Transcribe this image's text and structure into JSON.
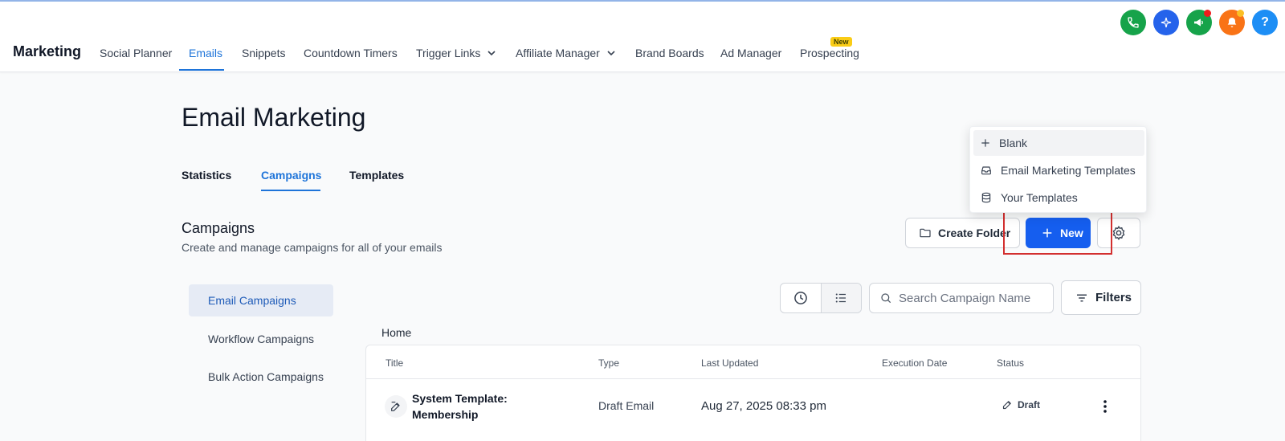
{
  "app": {
    "brand": "Marketing",
    "nav": [
      {
        "label": "Social Planner"
      },
      {
        "label": "Emails"
      },
      {
        "label": "Snippets"
      },
      {
        "label": "Countdown Timers"
      },
      {
        "label": "Trigger Links"
      },
      {
        "label": "Affiliate Manager"
      },
      {
        "label": "Brand Boards"
      },
      {
        "label": "Ad Manager"
      },
      {
        "label": "Prospecting"
      }
    ],
    "nav_new_badge": "New",
    "header_icons": [
      "phone-icon",
      "sparkle-icon",
      "megaphone-icon",
      "bell-icon",
      "help-icon"
    ],
    "help_glyph": "?",
    "colors": {
      "phone": "#16a34a",
      "sparkle": "#2563eb",
      "megaphone": "#16a34a",
      "bell": "#f97316",
      "help": "#1d8ef5",
      "accent": "#1e74d9",
      "primary": "#155eef"
    }
  },
  "page": {
    "title": "Email Marketing",
    "tabs": [
      {
        "label": "Statistics"
      },
      {
        "label": "Campaigns"
      },
      {
        "label": "Templates"
      }
    ]
  },
  "section": {
    "title": "Campaigns",
    "subtitle": "Create and manage campaigns for all of your emails",
    "create_folder_label": "Create Folder",
    "new_label": "New"
  },
  "new_menu": {
    "items": [
      {
        "label": "Blank",
        "icon": "plus-icon"
      },
      {
        "label": "Email Marketing Templates",
        "icon": "inbox-icon"
      },
      {
        "label": "Your Templates",
        "icon": "database-icon"
      }
    ]
  },
  "sidebar": {
    "items": [
      {
        "label": "Email Campaigns"
      },
      {
        "label": "Workflow Campaigns"
      },
      {
        "label": "Bulk Action Campaigns"
      }
    ]
  },
  "toolbar": {
    "search_placeholder": "Search Campaign Name",
    "filters_label": "Filters"
  },
  "breadcrumb": "Home",
  "table": {
    "headers": [
      "Title",
      "Type",
      "Last Updated",
      "Execution Date",
      "Status"
    ],
    "rows": [
      {
        "title": "System Template: Membership",
        "type": "Draft Email",
        "last_updated": "Aug 27, 2025 08:33 pm",
        "execution_date": "",
        "status": "Draft"
      }
    ]
  }
}
